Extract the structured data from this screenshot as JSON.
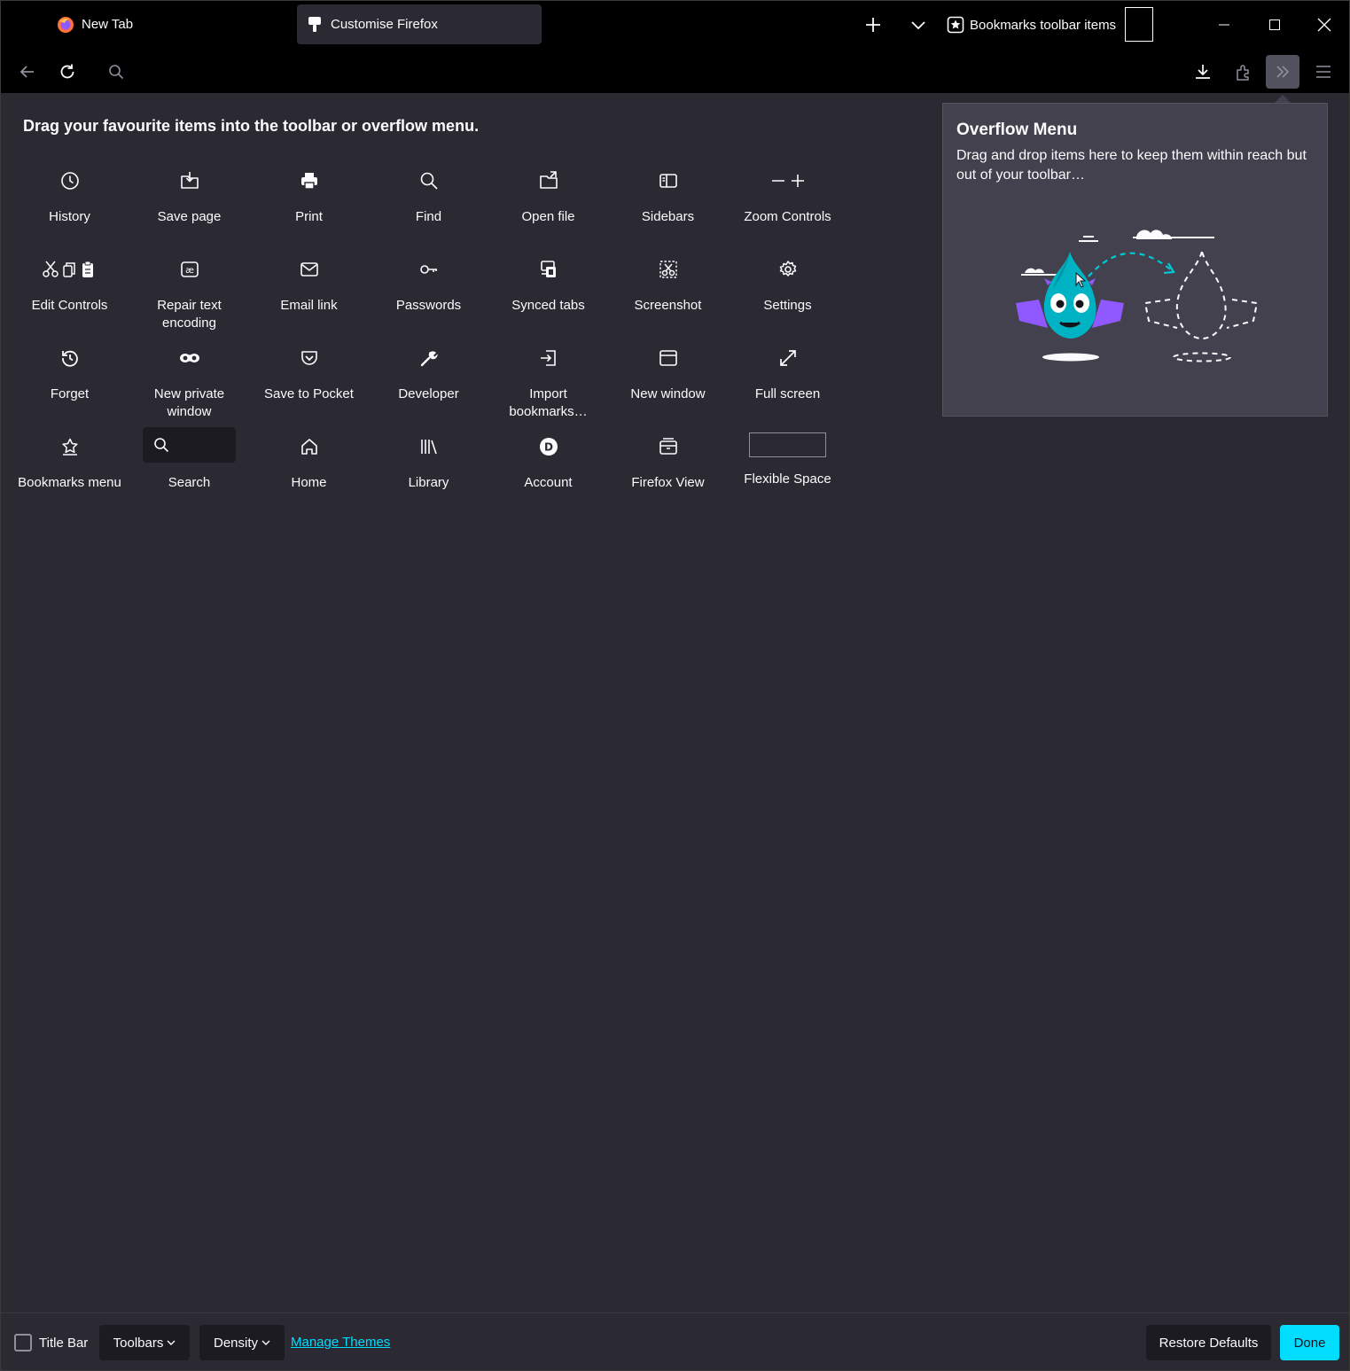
{
  "tabs": {
    "new_tab_label": "New Tab",
    "active_tab_label": "Customise Firefox"
  },
  "bookmarks_toolbar": {
    "label": "Bookmarks toolbar items"
  },
  "heading": "Drag your favourite items into the toolbar or overflow menu.",
  "palette": [
    {
      "label": "History",
      "icon": "history-icon"
    },
    {
      "label": "Save page",
      "icon": "save-page-icon"
    },
    {
      "label": "Print",
      "icon": "print-icon"
    },
    {
      "label": "Find",
      "icon": "find-icon"
    },
    {
      "label": "Open file",
      "icon": "open-file-icon"
    },
    {
      "label": "Sidebars",
      "icon": "sidebars-icon"
    },
    {
      "label": "Zoom Controls",
      "icon": "zoom-controls-icon"
    },
    {
      "label": "Edit Controls",
      "icon": "edit-controls-icon"
    },
    {
      "label": "Repair text encoding",
      "icon": "text-encoding-icon"
    },
    {
      "label": "Email link",
      "icon": "email-icon"
    },
    {
      "label": "Passwords",
      "icon": "key-icon"
    },
    {
      "label": "Synced tabs",
      "icon": "synced-tabs-icon"
    },
    {
      "label": "Screenshot",
      "icon": "screenshot-icon"
    },
    {
      "label": "Settings",
      "icon": "gear-icon"
    },
    {
      "label": "Forget",
      "icon": "forget-icon"
    },
    {
      "label": "New private window",
      "icon": "private-mask-icon"
    },
    {
      "label": "Save to Pocket",
      "icon": "pocket-icon"
    },
    {
      "label": "Developer",
      "icon": "wrench-icon"
    },
    {
      "label": "Import bookmarks…",
      "icon": "import-icon"
    },
    {
      "label": "New window",
      "icon": "new-window-icon"
    },
    {
      "label": "Full screen",
      "icon": "fullscreen-icon"
    },
    {
      "label": "Bookmarks menu",
      "icon": "bookmark-star-icon"
    },
    {
      "label": "Search",
      "icon": "search-icon"
    },
    {
      "label": "Home",
      "icon": "home-icon"
    },
    {
      "label": "Library",
      "icon": "library-icon"
    },
    {
      "label": "Account",
      "icon": "account-icon"
    },
    {
      "label": "Firefox View",
      "icon": "firefox-view-icon"
    },
    {
      "label": "Flexible Space",
      "icon": "flexible-space"
    }
  ],
  "overflow": {
    "title": "Overflow Menu",
    "description": "Drag and drop items here to keep them within reach but out of your toolbar…"
  },
  "footer": {
    "title_bar_label": "Title Bar",
    "toolbars_label": "Toolbars",
    "density_label": "Density",
    "manage_themes_label": "Manage Themes",
    "restore_defaults_label": "Restore Defaults",
    "done_label": "Done"
  },
  "colors": {
    "background": "#2b2a33",
    "chrome": "#000000",
    "accent": "#00ddff",
    "panel": "#42414d",
    "text": "#fbfbfe"
  }
}
